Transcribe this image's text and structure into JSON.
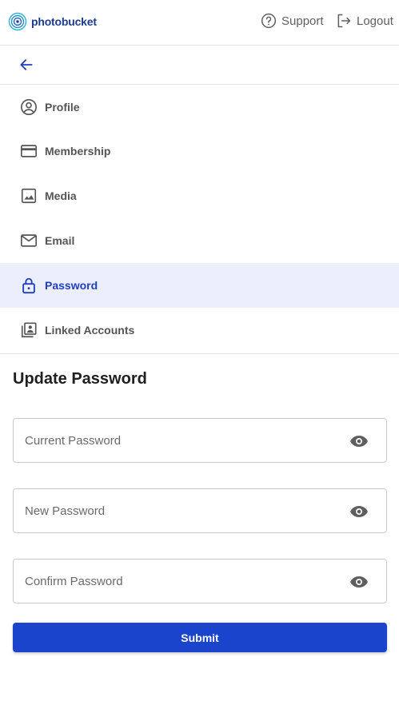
{
  "header": {
    "logo_text": "photobucket",
    "support_label": "Support",
    "logout_label": "Logout"
  },
  "nav": {
    "items": [
      {
        "label": "Profile",
        "icon": "account-circle-icon"
      },
      {
        "label": "Membership",
        "icon": "credit-card-icon"
      },
      {
        "label": "Media",
        "icon": "image-icon"
      },
      {
        "label": "Email",
        "icon": "mail-icon"
      },
      {
        "label": "Password",
        "icon": "lock-icon",
        "active": true
      },
      {
        "label": "Linked Accounts",
        "icon": "linked-accounts-icon"
      }
    ]
  },
  "form": {
    "title": "Update Password",
    "current_placeholder": "Current Password",
    "new_placeholder": "New Password",
    "confirm_placeholder": "Confirm Password",
    "submit_label": "Submit"
  },
  "colors": {
    "accent": "#1b44cc",
    "active_bg": "#eceefb",
    "logo": "#1c3d8f"
  }
}
